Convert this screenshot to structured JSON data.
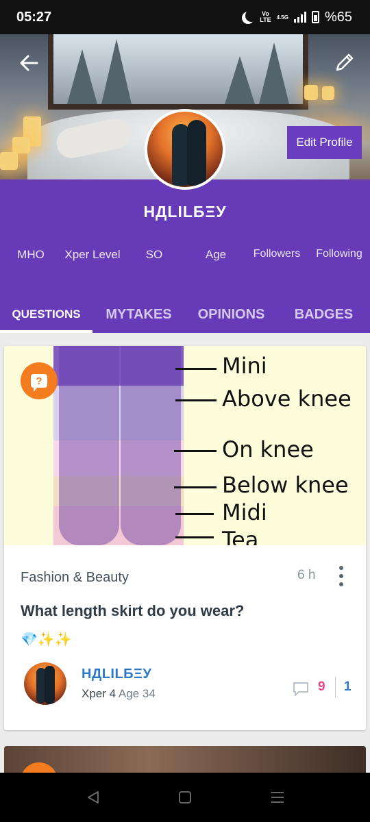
{
  "status_bar": {
    "time": "05:27",
    "network_top": "Vo",
    "network_bottom": "LTE",
    "network_gen": "4.5G",
    "battery": "%65"
  },
  "header": {
    "edit_profile_label": "Edit Profile"
  },
  "profile": {
    "username": "НДLILБΞУ",
    "stats": [
      "MHO",
      "Xper Level",
      "SO",
      "Age",
      "Followers",
      "Following"
    ]
  },
  "tabs": [
    {
      "label": "QUESTIONS",
      "active": true
    },
    {
      "label": "MYTAKES",
      "active": false
    },
    {
      "label": "OPINIONS",
      "active": false
    },
    {
      "label": "BADGES",
      "active": false
    }
  ],
  "post": {
    "image_labels": [
      "Mini",
      "Above knee",
      "On knee",
      "Below knee",
      "Midi",
      "Tea"
    ],
    "badge_glyph": "?",
    "category": "Fashion & Beauty",
    "time": "6 h",
    "title": "What length skirt do you wear?",
    "emoji": "💎✨✨",
    "author": {
      "name": "НДLILБΞУ",
      "xper": "Xper 4",
      "age": "Age 34"
    },
    "comment_count": "9",
    "second_count": "1"
  },
  "colors": {
    "brand_purple": "#673ab7",
    "badge_orange": "#f47c20",
    "link_blue": "#2a7ac8",
    "count_pink": "#e24585"
  }
}
